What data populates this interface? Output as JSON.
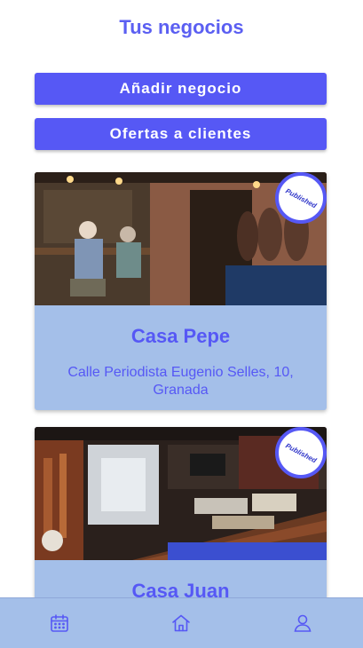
{
  "header": {
    "title": "Tus negocios"
  },
  "actions": {
    "add_business_label": "Añadir negocio",
    "offers_label": "Ofertas a clientes"
  },
  "businesses": [
    {
      "name": "Casa Pepe",
      "address": "Calle Periodista Eugenio Selles, 10, Granada",
      "status": "Published"
    },
    {
      "name": "Casa Juan",
      "address": "",
      "status": "Published"
    }
  ],
  "nav": {
    "items": [
      {
        "icon": "calendar-icon"
      },
      {
        "icon": "home-icon"
      },
      {
        "icon": "user-icon"
      }
    ]
  },
  "colors": {
    "accent": "#5658f5",
    "card_background": "#a4bfe9",
    "nav_background": "#a4bfe9"
  }
}
